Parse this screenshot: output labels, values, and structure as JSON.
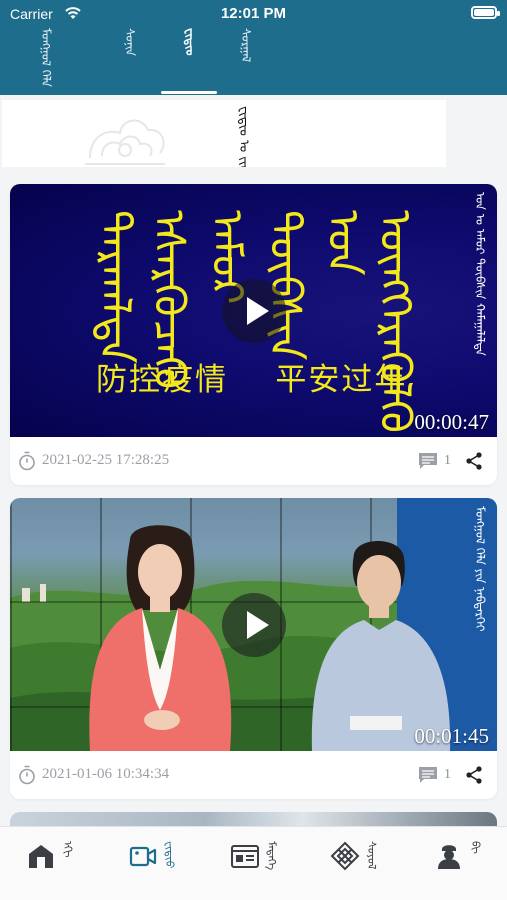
{
  "status_bar": {
    "carrier": "Carrier",
    "time": "12:01 PM"
  },
  "top_tabs": [
    {
      "label": "ᠮᠣᠩᠭᠣᠯ ᠬᠡᠯᠡ",
      "active": false
    },
    {
      "label": "ᠰᠣᠨᠢᠨ",
      "active": false
    },
    {
      "label": "ᠸᠢᠳᠢᠣ᠋",
      "active": true
    },
    {
      "label": "ᠰᠤᠷᠭᠠᠯ",
      "active": false
    }
  ],
  "banner": {
    "label": "ᠸᠢᠳᠢᠣ᠋ ᠤ ᠵᠢᠭᠰᠠᠭᠠᠯᠲᠠ"
  },
  "videos": [
    {
      "side_title": "ᠣᠨ ᠤ ᠠᠮᠤᠷ ᠲᠦᠪᠰᠢᠨ ᠬᠠᠮᠠᠭᠠᠯᠠᠯᠲᠠ",
      "mongol_slogan": [
        "ᠲᠠᠷᠬᠠᠯᠲᠠ",
        "ᠡᠰᠡᠷᠭᠦᠴᠡᠬᠦ",
        "ᠠᠮᠤᠷ",
        "ᠲᠦᠪᠰᠢᠨ",
        "ᠣᠨ",
        "ᠥᠩᠭᠡᠷᠡᠭᠦᠯᠬᠦ"
      ],
      "zh_caption": "防控疫情    平安过年",
      "duration": "00:00:47",
      "date": "2021-02-25 17:28:25",
      "comments": "1"
    },
    {
      "side_title": "ᠮᠣᠩᠭᠣᠯ ᠬᠡᠯᠡ ᠶᠢᠨ ᠨᠡᠪᠲᠡᠷᠬᠡᠢ",
      "duration": "00:01:45",
      "date": "2021-01-06 10:34:34",
      "comments": "1"
    }
  ],
  "bottom_nav": [
    {
      "icon": "home-icon",
      "label": "ᠡᠬᠢ",
      "active": false
    },
    {
      "icon": "video-icon",
      "label": "ᠸᠢᠳᠢᠣ",
      "active": true
    },
    {
      "icon": "news-card-icon",
      "label": "ᠮᠡᠳᠡᠭᠡ",
      "active": false
    },
    {
      "icon": "knot-icon",
      "label": "ᠰᠣᠶᠣᠯ",
      "active": false
    },
    {
      "icon": "profile-icon",
      "label": "ᠪᠢ",
      "active": false
    }
  ],
  "colors": {
    "header": "#1f6d8c",
    "accent": "#1f6d8c",
    "slogan": "#f3e81a"
  }
}
